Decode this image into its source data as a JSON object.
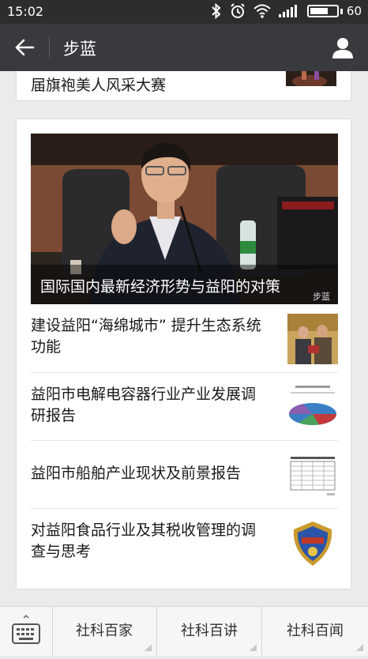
{
  "status": {
    "time": "15:02",
    "battery": "60",
    "battery_level": 0.6
  },
  "header": {
    "title": "步蓝"
  },
  "top_card": {
    "title": "届旗袍美人风采大赛"
  },
  "feature": {
    "caption": "国际国内最新经济形势与益阳的对策",
    "watermark": "步蓝"
  },
  "articles": [
    {
      "title": "建设益阳“海绵城市” 提升生态系统功能",
      "thumb": "photo-two-men"
    },
    {
      "title": "益阳市电解电容器行业产业发展调研报告",
      "thumb": "pie-chart"
    },
    {
      "title": "益阳市船舶产业现状及前景报告",
      "thumb": "data-table"
    },
    {
      "title": "对益阳食品行业及其税收管理的调查与思考",
      "thumb": "badge-emblem"
    }
  ],
  "bottom_menu": {
    "items": [
      "社科百家",
      "社科百讲",
      "社科百闻"
    ]
  }
}
